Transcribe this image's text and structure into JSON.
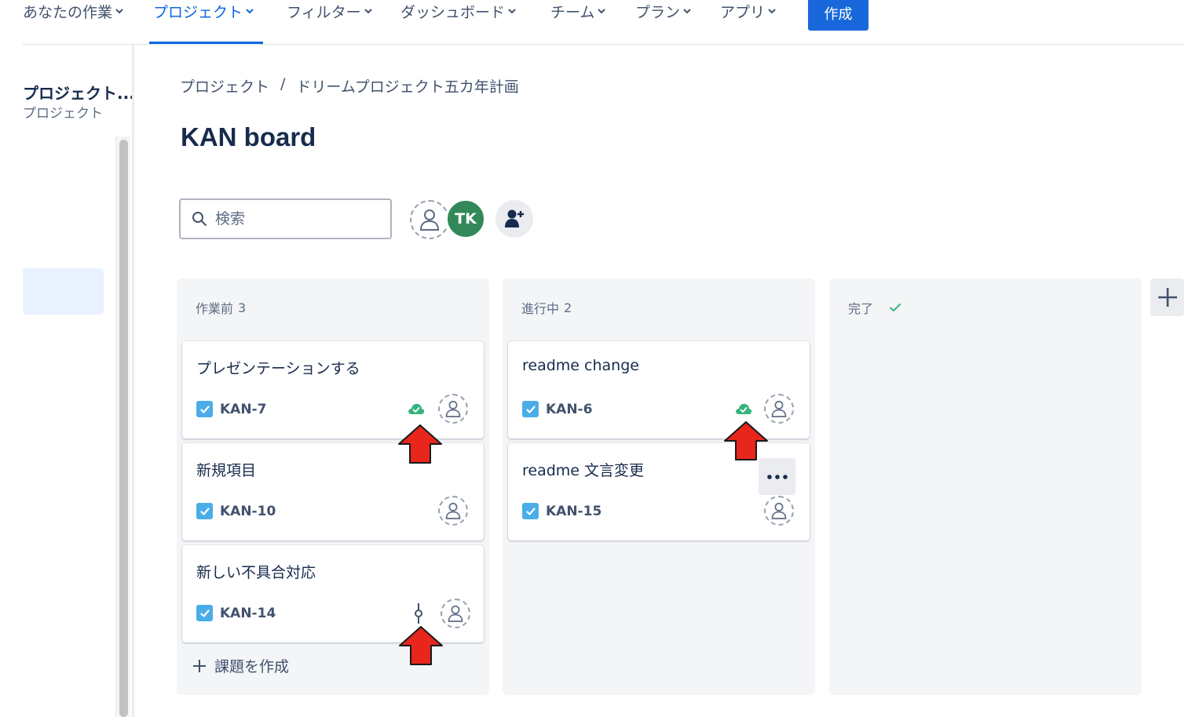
{
  "nav": {
    "items": [
      {
        "label": "あなたの作業"
      },
      {
        "label": "プロジェクト"
      },
      {
        "label": "フィルター"
      },
      {
        "label": "ダッシュボード"
      },
      {
        "label": "チーム"
      },
      {
        "label": "プラン"
      },
      {
        "label": "アプリ"
      }
    ],
    "create_label": "作成"
  },
  "sidebar": {
    "project_name": "プロジェクト...",
    "project_type": "プロジェクト"
  },
  "breadcrumb": {
    "items": [
      "プロジェクト",
      "ドリームプロジェクト五カ年計画"
    ],
    "separator": "/"
  },
  "page": {
    "title": "KAN board"
  },
  "search": {
    "placeholder": "検索",
    "value": ""
  },
  "avatars": {
    "tk_initials": "TK"
  },
  "columns": [
    {
      "title": "作業前",
      "count": "3",
      "cards": [
        {
          "summary": "プレゼンテーションする",
          "key": "KAN-7",
          "dev_icon": "cloud-check-icon"
        },
        {
          "summary": "新規項目",
          "key": "KAN-10",
          "dev_icon": ""
        },
        {
          "summary": "新しい不具合対応",
          "key": "KAN-14",
          "dev_icon": "commit-icon"
        }
      ],
      "create_label": "課題を作成"
    },
    {
      "title": "進行中",
      "count": "2",
      "cards": [
        {
          "summary": "readme change",
          "key": "KAN-6",
          "dev_icon": "cloud-check-icon"
        },
        {
          "summary": "readme 文言変更",
          "key": "KAN-15",
          "dev_icon": ""
        }
      ]
    },
    {
      "title": "完了",
      "count": "",
      "cards": []
    }
  ],
  "colors": {
    "accent": "#0c66e4",
    "create_button": "#1868db",
    "tk_avatar": "#328858",
    "deploy_green": "#36b37e",
    "task_blue": "#4bade8",
    "annotation_arrow": "#e8261c"
  }
}
